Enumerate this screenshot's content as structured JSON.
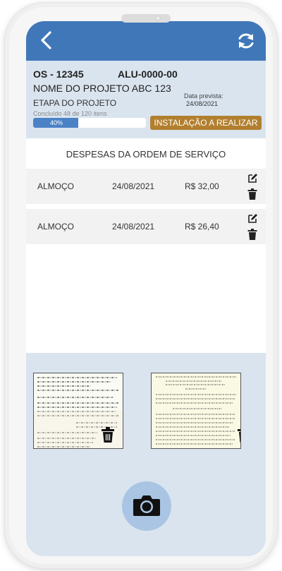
{
  "header": {
    "back_icon": "back-arrow-icon",
    "sync_icon": "sync-icon",
    "color": "#4077b8"
  },
  "project": {
    "os_number": "OS - 12345",
    "alu_number": "ALU-0000-00",
    "name": "NOME DO PROJETO ABC 123",
    "stage_label": "ETAPA DO PROJETO",
    "due_date_label": "Data prevista:",
    "due_date": "24/08/2021",
    "progress_caption": "Concluído 48 de 120 itens",
    "progress_text": "40%",
    "progress_fraction": 0.4,
    "status_button": "INSTALAÇÃO A REALIZAR",
    "status_color": "#b17f2e"
  },
  "expenses": {
    "title": "DESPESAS DA ORDEM DE SERVIÇO",
    "rows": [
      {
        "description": "ALMOÇO",
        "date": "24/08/2021",
        "value": "R$ 32,00"
      },
      {
        "description": "ALMOÇO",
        "date": "24/08/2021",
        "value": "R$ 26,40"
      }
    ]
  },
  "attachments": [
    {
      "type": "receipt",
      "icon": "trash-icon"
    },
    {
      "type": "receipt",
      "icon": "trash-icon"
    }
  ],
  "camera": {
    "icon": "camera-icon"
  }
}
